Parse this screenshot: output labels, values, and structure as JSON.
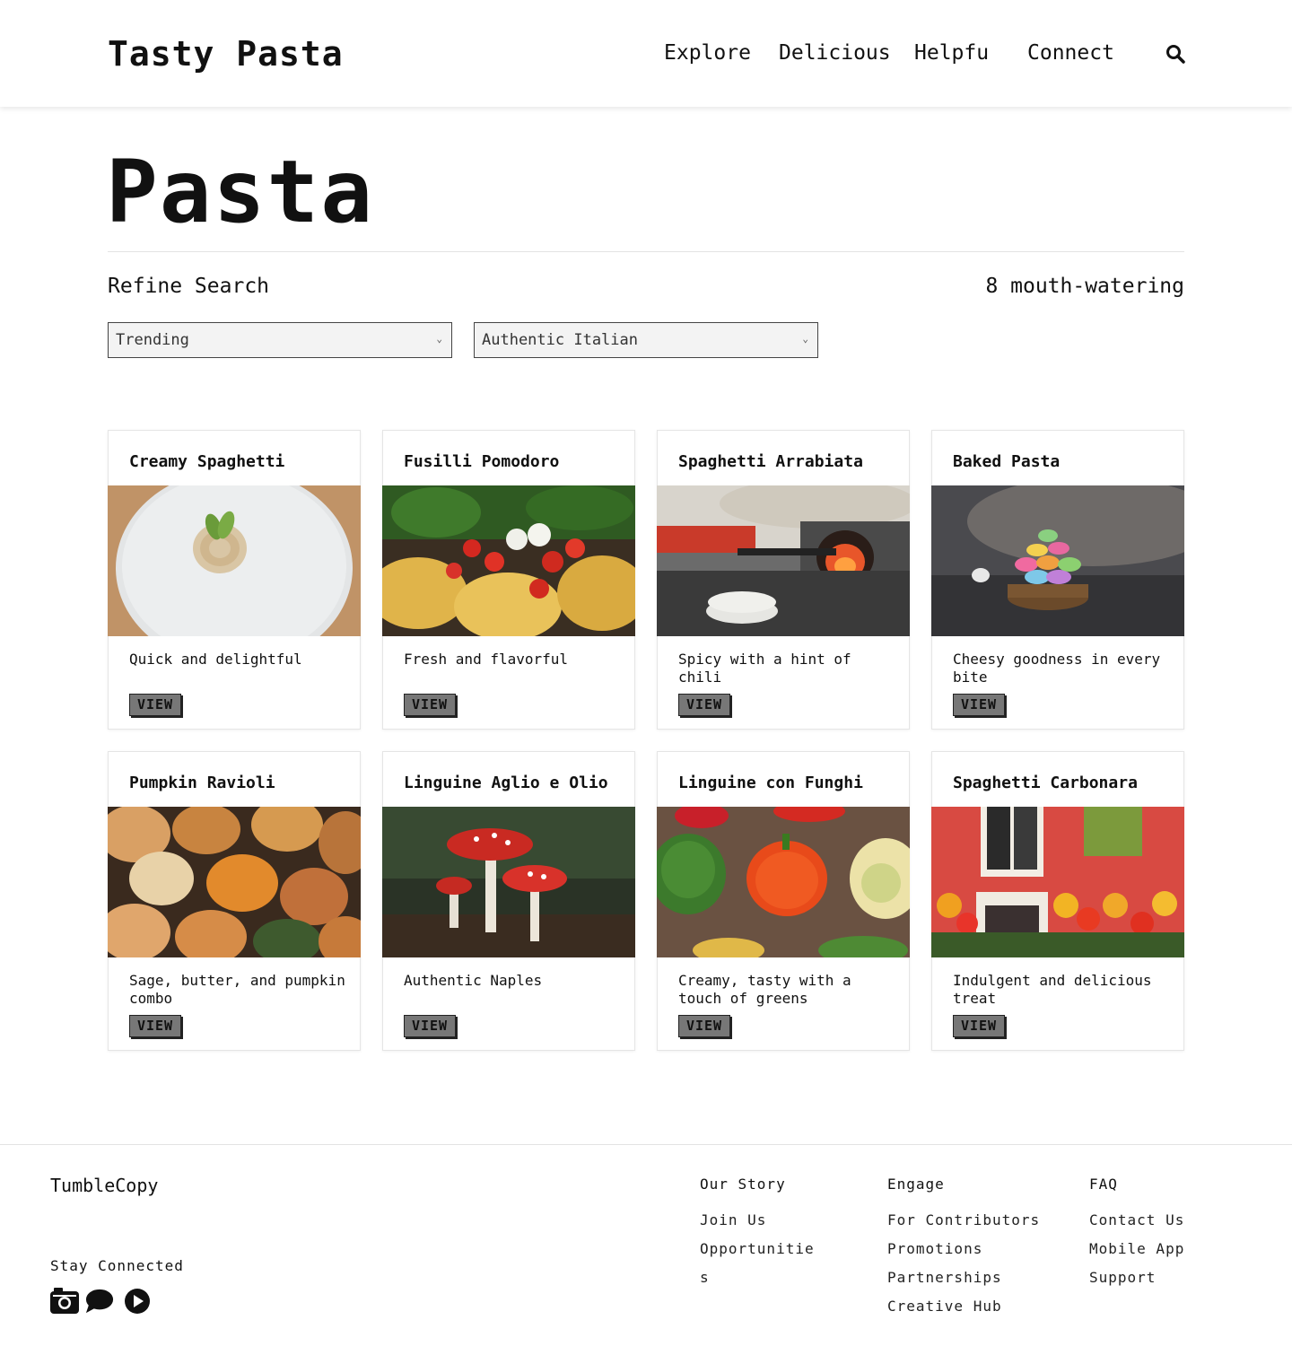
{
  "header": {
    "logo": "Tasty Pasta",
    "nav": [
      "Explore",
      "Delicious",
      "Helpfu",
      "Connect"
    ]
  },
  "main": {
    "title": "Pasta",
    "refine_label": "Refine Search",
    "result_count": "8 mouth-watering",
    "filters": [
      {
        "selected": "Trending"
      },
      {
        "selected": "Authentic Italian"
      }
    ],
    "view_label": "VIEW",
    "cards": [
      {
        "title": "Creamy Spaghetti",
        "desc": "Quick and delightful"
      },
      {
        "title": "Fusilli Pomodoro",
        "desc": "Fresh and flavorful"
      },
      {
        "title": "Spaghetti Arrabiata",
        "desc": "Spicy with a hint of chili"
      },
      {
        "title": "Baked Pasta",
        "desc": "Cheesy goodness in every bite"
      },
      {
        "title": "Pumpkin Ravioli",
        "desc": "Sage, butter, and pumpkin combo"
      },
      {
        "title": "Linguine Aglio e Olio",
        "desc": "Authentic Naples"
      },
      {
        "title": "Linguine con Funghi",
        "desc": "Creamy, tasty with a touch of greens"
      },
      {
        "title": "Spaghetti Carbonara",
        "desc": "Indulgent and delicious treat"
      }
    ]
  },
  "footer": {
    "brand": "TumbleCopy",
    "stay_connected": "Stay Connected",
    "social_icons": [
      "camera-icon",
      "chat-icon",
      "play-icon"
    ],
    "columns": [
      {
        "heading": "Our Story",
        "links": [
          "Join Us",
          "Opportunitie",
          "s"
        ]
      },
      {
        "heading": "Engage",
        "links": [
          "For Contributors",
          "Promotions",
          "Partnerships",
          "Creative Hub"
        ]
      },
      {
        "heading": "FAQ",
        "links": [
          "Contact Us",
          "Mobile App",
          "Support"
        ]
      }
    ]
  }
}
